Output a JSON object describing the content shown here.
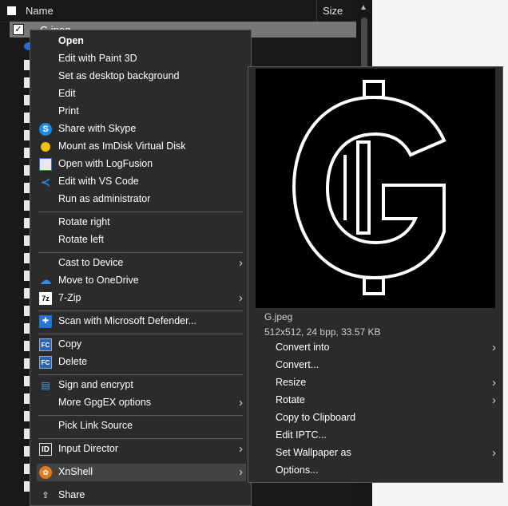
{
  "explorer": {
    "column_name": "Name",
    "column_size": "Size",
    "selected_file": "G.jpeg"
  },
  "context_menu": {
    "group1": [
      {
        "label": "Open",
        "icon": "none",
        "bold": true
      },
      {
        "label": "Edit with Paint 3D",
        "icon": "none"
      },
      {
        "label": "Set as desktop background",
        "icon": "none"
      },
      {
        "label": "Edit",
        "icon": "none"
      },
      {
        "label": "Print",
        "icon": "none"
      },
      {
        "label": "Share with Skype",
        "icon": "skype-icon"
      },
      {
        "label": "Mount as ImDisk Virtual Disk",
        "icon": "imdisk-icon"
      },
      {
        "label": "Open with LogFusion",
        "icon": "logfusion-icon"
      },
      {
        "label": "Edit with VS Code",
        "icon": "vscode-icon"
      },
      {
        "label": "Run as administrator",
        "icon": "none"
      }
    ],
    "group2": [
      {
        "label": "Rotate right"
      },
      {
        "label": "Rotate left"
      }
    ],
    "group3": [
      {
        "label": "Cast to Device",
        "submenu": true
      },
      {
        "label": "Move to OneDrive",
        "icon": "onedrive-icon"
      },
      {
        "label": "7-Zip",
        "icon": "7zip-icon",
        "submenu": true
      }
    ],
    "group4": [
      {
        "label": "Scan with Microsoft Defender...",
        "icon": "defender-icon"
      }
    ],
    "group5": [
      {
        "label": "Copy",
        "icon": "fastcopy-icon"
      },
      {
        "label": "Delete",
        "icon": "fastcopy-icon"
      }
    ],
    "group6": [
      {
        "label": "Sign and encrypt",
        "icon": "gpg-icon"
      },
      {
        "label": "More GpgEX options",
        "submenu": true
      }
    ],
    "group7": [
      {
        "label": "Pick Link Source"
      }
    ],
    "group8": [
      {
        "label": "Input Director",
        "icon": "inputdirector-icon",
        "submenu": true
      },
      {
        "label": "XnShell",
        "icon": "xnshell-icon",
        "submenu": true,
        "highlighted": true
      },
      {
        "label": "Share",
        "icon": "share-icon"
      }
    ]
  },
  "xnshell": {
    "preview_label": "G.jpeg",
    "preview_info": "512x512, 24 bpp, 33.57 KB",
    "items": [
      {
        "label": "Convert into",
        "submenu": true
      },
      {
        "label": "Convert...",
        "submenu": false
      },
      {
        "label": "Resize",
        "submenu": true
      },
      {
        "label": "Rotate",
        "submenu": true
      },
      {
        "label": "Copy to Clipboard",
        "submenu": false
      },
      {
        "label": "Edit IPTC...",
        "submenu": false
      },
      {
        "label": "Set Wallpaper as",
        "submenu": true
      },
      {
        "label": "Options...",
        "submenu": false
      }
    ]
  },
  "colors": {
    "menu_bg": "#2b2b2b",
    "highlight": "#434343",
    "separator": "#595959"
  }
}
